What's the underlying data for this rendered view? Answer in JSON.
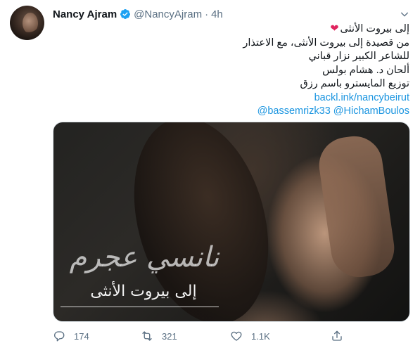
{
  "tweet": {
    "display_name": "Nancy Ajram",
    "handle": "@NancyAjram",
    "separator": "·",
    "time": "4h",
    "lines": [
      "إلى بيروت الأنثى",
      "من قصيدة إلى بيروت الأنثى، مع الاعتذار",
      "للشاعر الكبير نزار قباني",
      "ألحان د. هشام بولس",
      "توزيع المايسترو  باسم رزق"
    ],
    "heart": "❤",
    "link": "backl.ink/nancybeirut",
    "mentions": "@bassemrizk33 @HichamBoulos"
  },
  "media": {
    "overlay_title": "نانسي عجرم",
    "overlay_subtitle": "إلى بيروت الأنثى"
  },
  "actions": {
    "reply_count": "174",
    "retweet_count": "321",
    "like_count": "1.1K"
  },
  "colors": {
    "verified": "#1da1f2",
    "link": "#1b95e0",
    "heart": "#e0245e",
    "muted": "#5b7083"
  },
  "icons": [
    "verified-badge-icon",
    "chevron-down-icon",
    "reply-icon",
    "retweet-icon",
    "like-icon",
    "share-icon"
  ]
}
